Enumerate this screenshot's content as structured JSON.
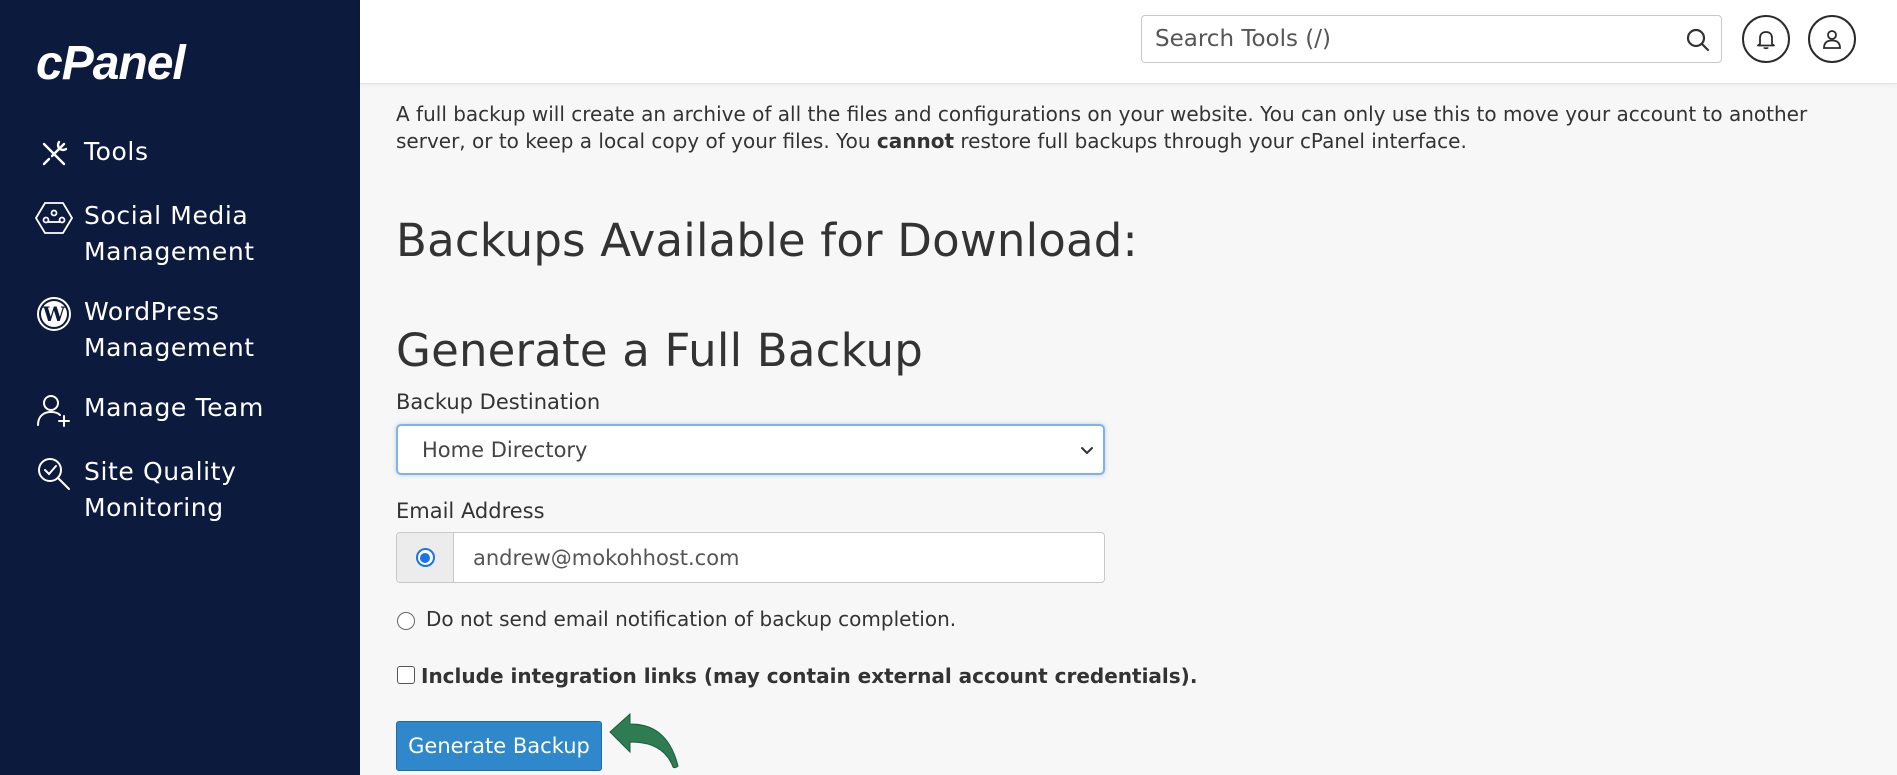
{
  "app": {
    "logo_text": "cPanel"
  },
  "sidebar": {
    "items": [
      {
        "label_line1": "Tools",
        "label_line2": "",
        "icon": "tools-icon"
      },
      {
        "label_line1": "Social Media",
        "label_line2": "Management",
        "icon": "social-media-icon"
      },
      {
        "label_line1": "WordPress",
        "label_line2": "Management",
        "icon": "wordpress-icon"
      },
      {
        "label_line1": "Manage Team",
        "label_line2": "",
        "icon": "manage-team-icon"
      },
      {
        "label_line1": "Site Quality",
        "label_line2": "Monitoring",
        "icon": "site-quality-icon"
      }
    ]
  },
  "header": {
    "search_placeholder": "Search Tools (/)",
    "icons": [
      "search-icon",
      "bell-icon",
      "user-icon"
    ]
  },
  "main": {
    "intro_part1": "A full backup will create an archive of all the files and configurations on your website. You can only use this to move your account to another server, or to keep a local copy of your files. You ",
    "intro_bold": "cannot",
    "intro_part2": " restore full backups through your cPanel interface.",
    "heading_available": "Backups Available for Download:",
    "heading_generate": "Generate a Full Backup",
    "destination_label": "Backup Destination",
    "destination_value": "Home Directory",
    "email_label": "Email Address",
    "email_value": "andrew@mokohhost.com",
    "no_email_option": "Do not send email notification of backup completion.",
    "integration_checkbox": "Include integration links (may contain external account credentials).",
    "generate_button": "Generate Backup"
  },
  "colors": {
    "sidebar_bg": "#0c1a3d",
    "primary_button": "#2f87cc",
    "annotation_arrow": "#2e7d52"
  }
}
